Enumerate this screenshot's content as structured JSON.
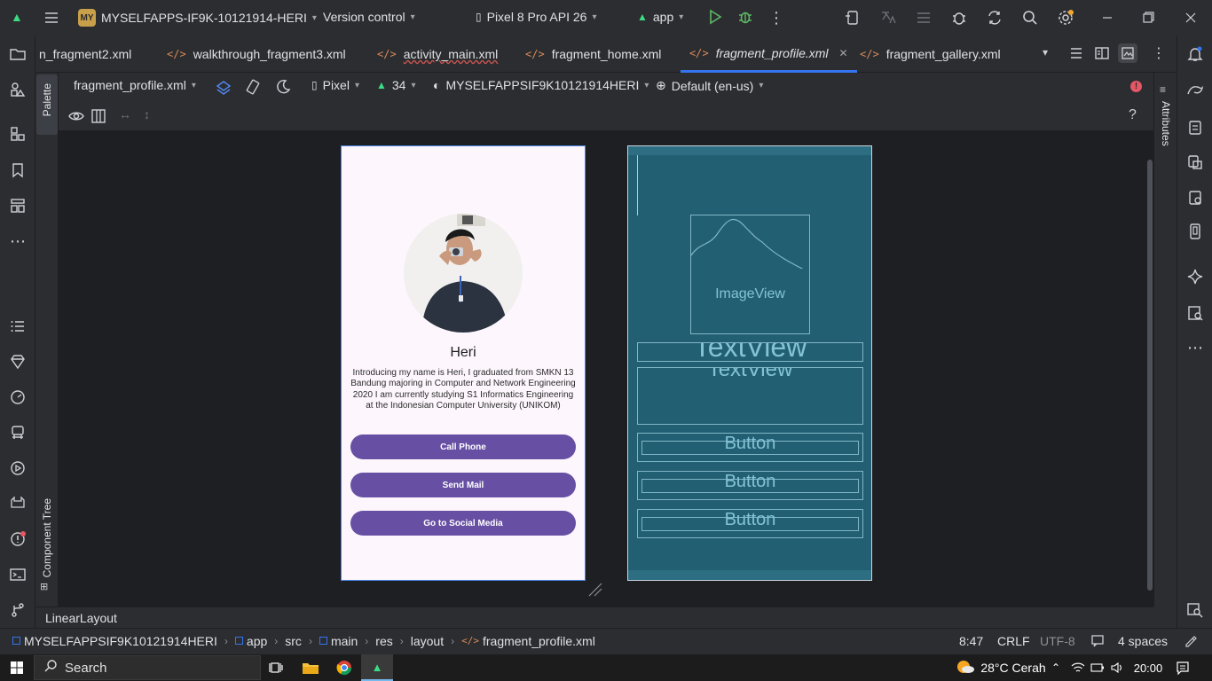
{
  "titlebar": {
    "project_badge": "MY",
    "project_name": "MYSELFAPPS-IF9K-10121914-HERI",
    "version_control": "Version control",
    "device": "Pixel 8 Pro API 26",
    "run_config": "app"
  },
  "tabs": [
    {
      "label": "n_fragment2.xml"
    },
    {
      "label": "walkthrough_fragment3.xml"
    },
    {
      "label": "activity_main.xml"
    },
    {
      "label": "fragment_home.xml"
    },
    {
      "label": "fragment_profile.xml"
    },
    {
      "label": "fragment_gallery.xml"
    }
  ],
  "design_toolbar": {
    "file": "fragment_profile.xml",
    "device": "Pixel",
    "api": "34",
    "theme": "MYSELFAPPSIF9K10121914HERI",
    "locale": "Default (en-us)"
  },
  "side_panels": {
    "palette": "Palette",
    "component_tree": "Component Tree",
    "attributes": "Attributes"
  },
  "preview": {
    "name": "Heri",
    "description": "Introducing my name is Heri, I graduated from SMKN 13 Bandung majoring in Computer and Network Engineering 2020 I am currently studying S1 Informatics Engineering at the Indonesian Computer University (UNIKOM)",
    "buttons": [
      "Call Phone",
      "Send Mail",
      "Go to Social Media"
    ]
  },
  "blueprint": {
    "imageview": "ImageView",
    "textview1": "TextView",
    "textview2": "TextView",
    "buttons": [
      "Button",
      "Button",
      "Button"
    ]
  },
  "status": {
    "selected": "LinearLayout",
    "cursor": "8:47",
    "line_sep": "CRLF",
    "encoding": "UTF-8",
    "indent": "4 spaces"
  },
  "breadcrumbs": [
    "MYSELFAPPSIF9K10121914HERI",
    "app",
    "src",
    "main",
    "res",
    "layout",
    "fragment_profile.xml"
  ],
  "taskbar": {
    "search": "Search",
    "weather": "28°C  Cerah",
    "time": "20:00"
  },
  "colors": {
    "accent": "#3574f0",
    "button": "#6750a4",
    "blueprint": "#235f73"
  }
}
